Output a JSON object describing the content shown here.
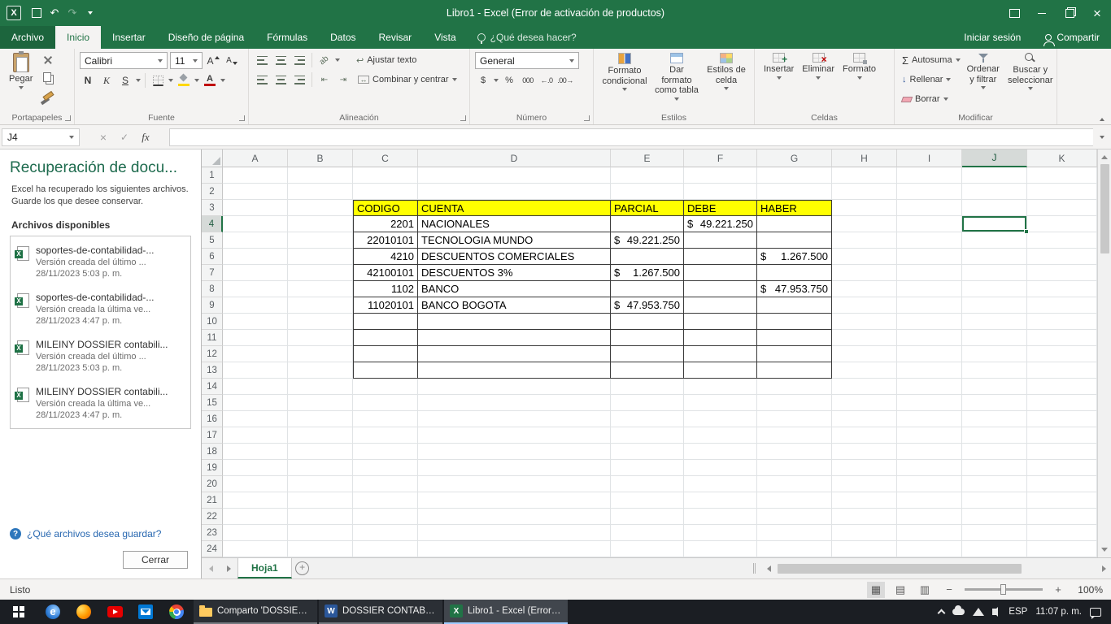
{
  "title_bar": {
    "title": "Libro1 - Excel (Error de activación de productos)"
  },
  "menu": {
    "file": "Archivo",
    "tabs": [
      "Inicio",
      "Insertar",
      "Diseño de página",
      "Fórmulas",
      "Datos",
      "Revisar",
      "Vista"
    ],
    "tell_me": "¿Qué desea hacer?",
    "sign_in": "Iniciar sesión",
    "share": "Compartir"
  },
  "ribbon": {
    "clipboard": {
      "group": "Portapapeles",
      "paste": "Pegar"
    },
    "font": {
      "group": "Fuente",
      "name": "Calibri",
      "size": "11",
      "bold": "N",
      "italic": "K",
      "underline": "S"
    },
    "alignment": {
      "group": "Alineación",
      "wrap": "Ajustar texto",
      "merge": "Combinar y centrar"
    },
    "number": {
      "group": "Número",
      "format": "General",
      "currency": "$",
      "percent": "%",
      "thousands": "000",
      "inc_decimal": "←.0",
      "dec_decimal": ".00→"
    },
    "styles": {
      "group": "Estilos",
      "conditional": "Formato condicional",
      "format_table": "Dar formato como tabla",
      "cell_styles": "Estilos de celda"
    },
    "cells": {
      "group": "Celdas",
      "insert": "Insertar",
      "delete": "Eliminar",
      "format": "Formato"
    },
    "editing": {
      "group": "Modificar",
      "autosum": "Autosuma",
      "fill": "Rellenar",
      "clear": "Borrar",
      "sort": "Ordenar y filtrar",
      "find": "Buscar y seleccionar"
    }
  },
  "formula_bar": {
    "name_box": "J4",
    "fx": "fx",
    "formula": ""
  },
  "recovery": {
    "title": "Recuperación de docu...",
    "desc": "Excel ha recuperado los siguientes archivos. Guarde los que desee conservar.",
    "available_heading": "Archivos disponibles",
    "files": [
      {
        "name": "soportes-de-contabilidad-...",
        "version": "Versión creada del último ...",
        "date": "28/11/2023 5:03 p. m."
      },
      {
        "name": "soportes-de-contabilidad-...",
        "version": "Versión creada la última ve...",
        "date": "28/11/2023 4:47 p. m."
      },
      {
        "name": "MILEINY DOSSIER contabili...",
        "version": "Versión creada del último ...",
        "date": "28/11/2023 5:03 p. m."
      },
      {
        "name": "MILEINY DOSSIER contabili...",
        "version": "Versión creada la última ve...",
        "date": "28/11/2023 4:47 p. m."
      }
    ],
    "question": "¿Qué archivos desea guardar?",
    "close_button": "Cerrar"
  },
  "sheet": {
    "col_headers": [
      "A",
      "B",
      "C",
      "D",
      "E",
      "F",
      "G",
      "H",
      "I",
      "J",
      "K"
    ],
    "visible_rows": 24,
    "selected_col": "J",
    "selected_row": 4,
    "table_range": {
      "first_col": "C",
      "last_col": "G",
      "first_row": 3,
      "last_row": 13,
      "header_row": 3
    },
    "cells": [
      {
        "ref": "C3",
        "text": "CODIGO"
      },
      {
        "ref": "D3",
        "text": "CUENTA"
      },
      {
        "ref": "E3",
        "text": "PARCIAL"
      },
      {
        "ref": "F3",
        "text": "DEBE"
      },
      {
        "ref": "G3",
        "text": "HABER"
      },
      {
        "ref": "C4",
        "text": "2201",
        "align": "right"
      },
      {
        "ref": "D4",
        "text": "NACIONALES"
      },
      {
        "ref": "F4",
        "cur": "$",
        "amount": "49.221.250"
      },
      {
        "ref": "C5",
        "text": "22010101",
        "align": "right"
      },
      {
        "ref": "D5",
        "text": "TECNOLOGIA MUNDO"
      },
      {
        "ref": "E5",
        "cur": "$",
        "amount": "49.221.250"
      },
      {
        "ref": "C6",
        "text": "4210",
        "align": "right"
      },
      {
        "ref": "D6",
        "text": "DESCUENTOS COMERCIALES"
      },
      {
        "ref": "G6",
        "cur": "$",
        "amount": "1.267.500"
      },
      {
        "ref": "C7",
        "text": "42100101",
        "align": "right"
      },
      {
        "ref": "D7",
        "text": "DESCUENTOS 3%"
      },
      {
        "ref": "E7",
        "cur": "$",
        "amount": "1.267.500"
      },
      {
        "ref": "C8",
        "text": "1102",
        "align": "right"
      },
      {
        "ref": "D8",
        "text": "BANCO"
      },
      {
        "ref": "G8",
        "cur": "$",
        "amount": "47.953.750"
      },
      {
        "ref": "C9",
        "text": "11020101",
        "align": "right"
      },
      {
        "ref": "D9",
        "text": "BANCO BOGOTA"
      },
      {
        "ref": "E9",
        "cur": "$",
        "amount": "47.953.750"
      }
    ]
  },
  "tab_bar": {
    "sheet": "Hoja1"
  },
  "status_bar": {
    "mode": "Listo",
    "zoom": "100%"
  },
  "taskbar": {
    "apps": [
      {
        "label": "Comparto 'DOSSIER ...",
        "icon": "folder"
      },
      {
        "label": "DOSSIER CONTABILID...",
        "icon": "word"
      },
      {
        "label": "Libro1 - Excel (Error d...",
        "icon": "excel",
        "active": true
      }
    ],
    "lang": "ESP",
    "time": "11:07 p. m."
  }
}
